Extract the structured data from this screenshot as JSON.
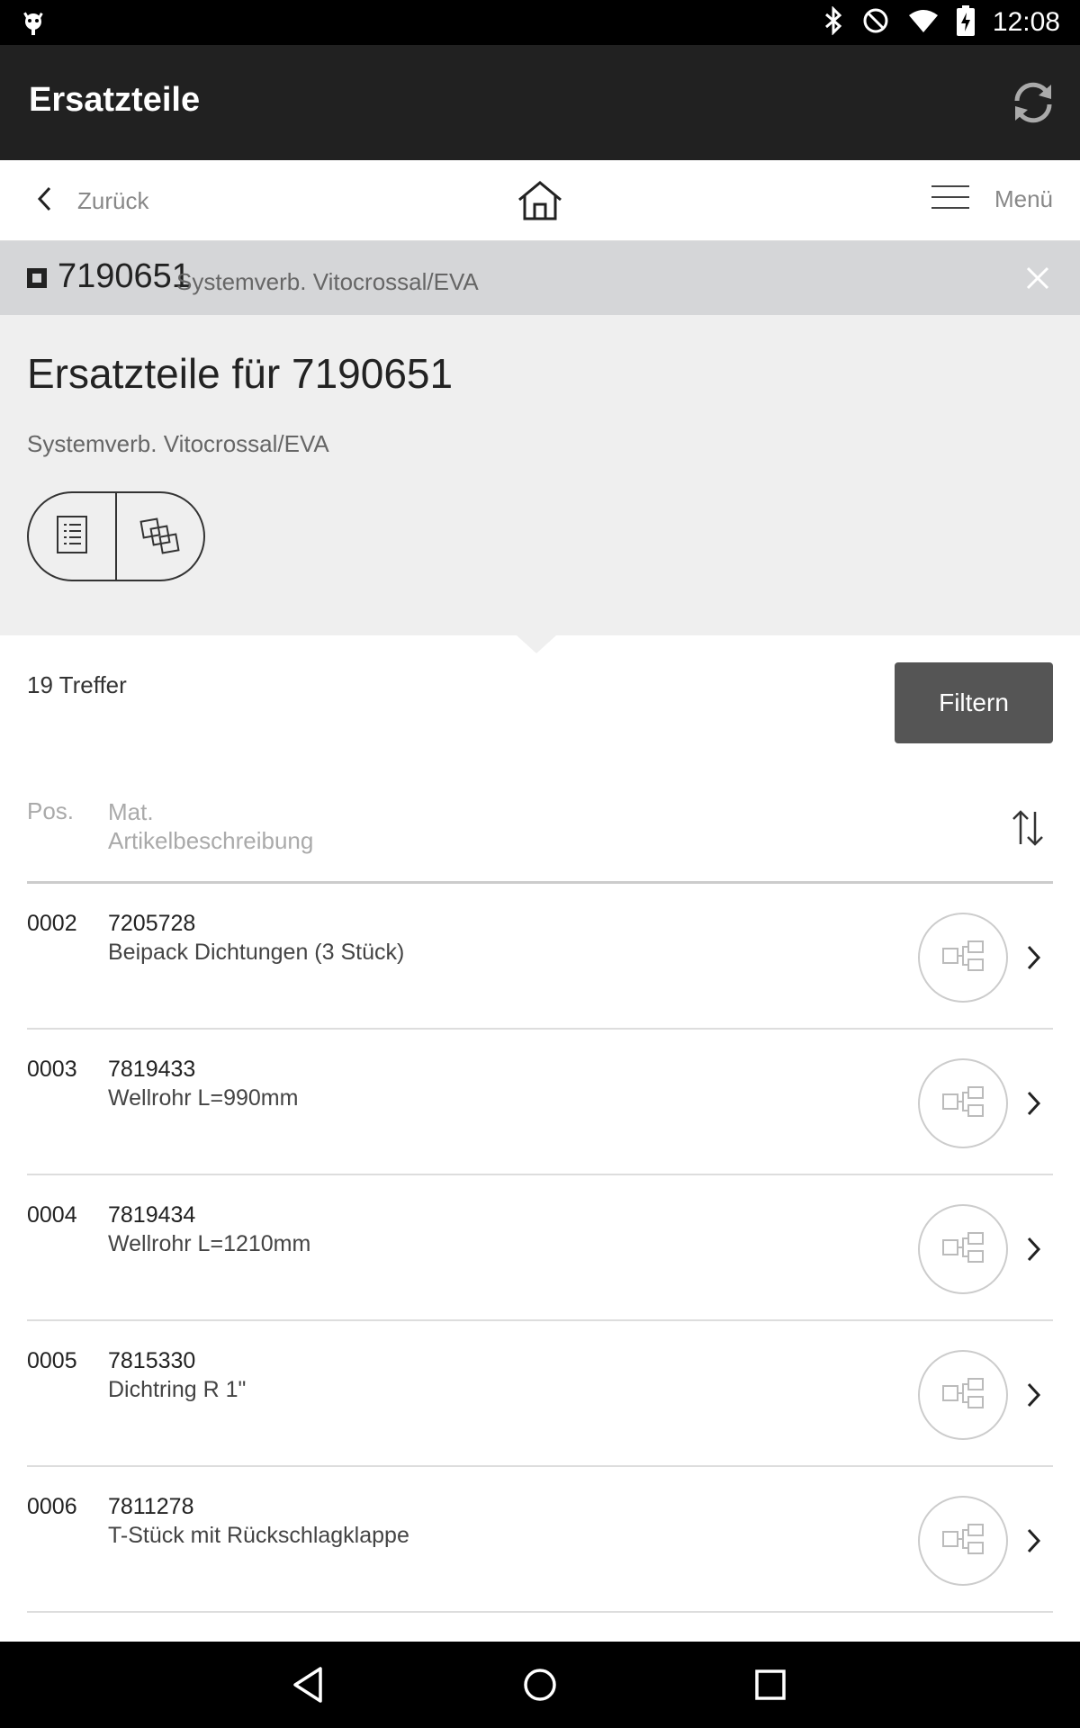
{
  "status_bar": {
    "time": "12:08",
    "icons": [
      "android-debug-icon",
      "bluetooth-icon",
      "do-not-disturb-icon",
      "wifi-icon",
      "battery-charging-icon"
    ]
  },
  "app_bar": {
    "title": "Ersatzteile",
    "refresh_icon": "refresh-icon"
  },
  "nav": {
    "back_label": "Zurück",
    "menu_label": "Menü"
  },
  "item_bar": {
    "number": "7190651",
    "description": "Systemverb. Vitocrossal/EVA"
  },
  "header": {
    "title": "Ersatzteile für 7190651",
    "subtitle": "Systemverb. Vitocrossal/EVA",
    "view_toggle": [
      "list-view-icon",
      "exploded-view-icon"
    ]
  },
  "results": {
    "count_label": "19 Treffer",
    "filter_label": "Filtern"
  },
  "columns": {
    "pos": "Pos.",
    "mat": "Mat.",
    "description": "Artikelbeschreibung"
  },
  "rows": [
    {
      "pos": "0002",
      "mat": "7205728",
      "desc": "Beipack Dichtungen (3 Stück)"
    },
    {
      "pos": "0003",
      "mat": "7819433",
      "desc": "Wellrohr L=990mm"
    },
    {
      "pos": "0004",
      "mat": "7819434",
      "desc": "Wellrohr L=1210mm"
    },
    {
      "pos": "0005",
      "mat": "7815330",
      "desc": "Dichtring R 1\""
    },
    {
      "pos": "0006",
      "mat": "7811278",
      "desc": "T-Stück mit Rückschlagklappe"
    }
  ],
  "colors": {
    "status_bar": "#000000",
    "app_bar": "#212121",
    "item_bar": "#d5d6d8",
    "header_bg": "#efefef",
    "filter_button": "#555555"
  }
}
